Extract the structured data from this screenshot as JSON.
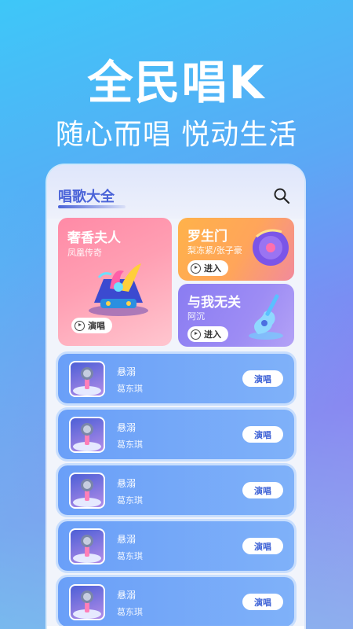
{
  "promo": {
    "headline": "全民唱K",
    "subline": "随心而唱 悦动生活"
  },
  "app": {
    "title": "唱歌大全",
    "feature": {
      "title": "奢香夫人",
      "subtitle": "凤凰传奇",
      "button": "演唱"
    },
    "cards": [
      {
        "title": "罗生门",
        "subtitle": "梨冻紧/张子豪",
        "button": "进入"
      },
      {
        "title": "与我无关",
        "subtitle": "阿沉",
        "button": "进入"
      }
    ],
    "songs": [
      {
        "title": "悬溺",
        "artist": "葛东琪",
        "button": "演唱"
      },
      {
        "title": "悬溺",
        "artist": "葛东琪",
        "button": "演唱"
      },
      {
        "title": "悬溺",
        "artist": "葛东琪",
        "button": "演唱"
      },
      {
        "title": "悬溺",
        "artist": "葛东琪",
        "button": "演唱"
      },
      {
        "title": "悬溺",
        "artist": "葛东琪",
        "button": "演唱"
      }
    ],
    "tabs": [
      "home-icon",
      "list-icon",
      "profile-icon"
    ]
  },
  "colors": {
    "accent": "#4a63d8",
    "row": "#6a9ff8",
    "feature": "#ff8aa6",
    "card_orange": "#ffb24a",
    "card_purple": "#8a7cf2"
  }
}
